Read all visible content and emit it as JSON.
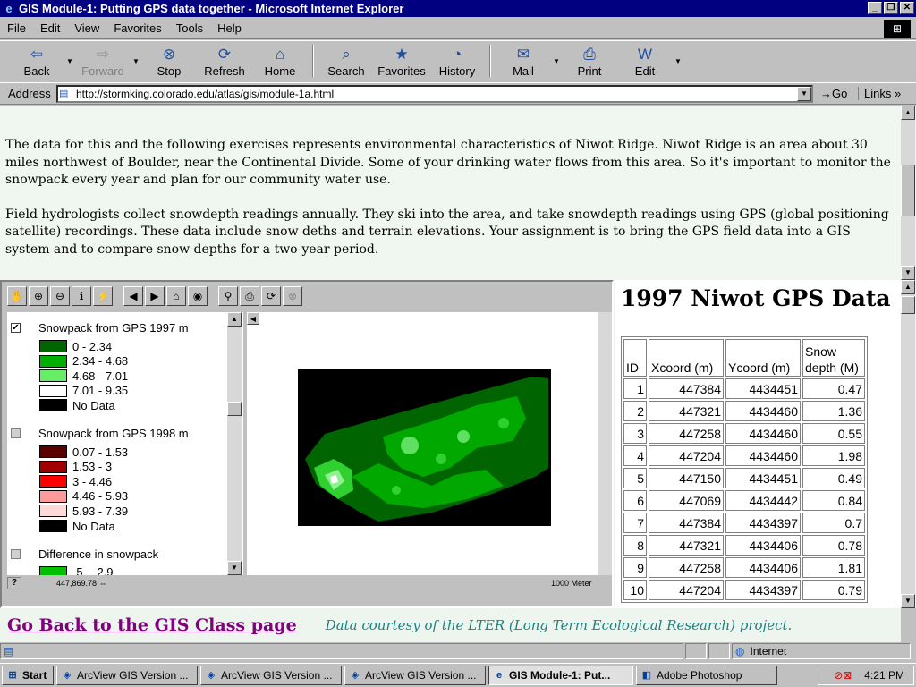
{
  "window": {
    "title": "GIS Module-1: Putting GPS data together - Microsoft Internet Explorer"
  },
  "menu": [
    "File",
    "Edit",
    "View",
    "Favorites",
    "Tools",
    "Help"
  ],
  "toolbar": [
    {
      "label": "Back",
      "glyph": "⇦",
      "enabled": true
    },
    {
      "label": "Forward",
      "glyph": "⇨",
      "enabled": false
    },
    {
      "label": "Stop",
      "glyph": "⊗",
      "enabled": true
    },
    {
      "label": "Refresh",
      "glyph": "⟳",
      "enabled": true
    },
    {
      "label": "Home",
      "glyph": "⌂",
      "enabled": true
    },
    {
      "label": "Search",
      "glyph": "⌕",
      "enabled": true
    },
    {
      "label": "Favorites",
      "glyph": "★",
      "enabled": true
    },
    {
      "label": "History",
      "glyph": "◔",
      "enabled": true
    },
    {
      "label": "Mail",
      "glyph": "✉",
      "enabled": true
    },
    {
      "label": "Print",
      "glyph": "⎙",
      "enabled": true
    },
    {
      "label": "Edit",
      "glyph": "W",
      "enabled": true
    }
  ],
  "address": {
    "label": "Address",
    "url": "http://stormking.colorado.edu/atlas/gis/module-1a.html",
    "go": "Go",
    "links": "Links"
  },
  "content": {
    "para1": "The data for this and the following exercises represents environmental characteristics of Niwot Ridge. Niwot Ridge is an area about 30 miles northwest of Boulder, near the Continental Divide. Some of your drinking water flows from this area. So it's important to monitor the snowpack every year and plan for our community water use.",
    "para2": "Field hydrologists collect snowdepth readings annually. They ski into the area, and take snowdepth readings using GPS (global positioning satellite) recordings. These data include snow deths and terrain elevations. Your assignment is to bring the GPS field data into a GIS system and to compare snow depths for a two-year period."
  },
  "gis": {
    "layers": [
      {
        "name": "Snowpack from GPS 1997 m",
        "checked": true,
        "classes": [
          {
            "label": "0 - 2.34",
            "color": "#006400"
          },
          {
            "label": "2.34 - 4.68",
            "color": "#00b000"
          },
          {
            "label": "4.68 - 7.01",
            "color": "#66ee66"
          },
          {
            "label": "7.01 - 9.35",
            "color": "#ffffff"
          },
          {
            "label": "No Data",
            "color": "#000000"
          }
        ]
      },
      {
        "name": "Snowpack from GPS 1998 m",
        "checked": false,
        "classes": [
          {
            "label": "0.07 - 1.53",
            "color": "#5a0000"
          },
          {
            "label": "1.53 - 3",
            "color": "#a00000"
          },
          {
            "label": "3 - 4.46",
            "color": "#ff0000"
          },
          {
            "label": "4.46 - 5.93",
            "color": "#ff9a9a"
          },
          {
            "label": "5.93 - 7.39",
            "color": "#ffd8d8"
          },
          {
            "label": "No Data",
            "color": "#000000"
          }
        ]
      },
      {
        "name": "Difference in snowpack",
        "checked": false,
        "classes": [
          {
            "label": "-5 - -2.9",
            "color": "#00c000"
          }
        ]
      }
    ],
    "coord": "447,869.78",
    "scale": "1000 Meter"
  },
  "table": {
    "title": "1997 Niwot GPS Data",
    "headers": [
      "ID",
      "Xcoord (m)",
      "Ycoord (m)",
      "Snow depth (M)"
    ],
    "rows": [
      [
        "1",
        "447384",
        "4434451",
        "0.47"
      ],
      [
        "2",
        "447321",
        "4434460",
        "1.36"
      ],
      [
        "3",
        "447258",
        "4434460",
        "0.55"
      ],
      [
        "4",
        "447204",
        "4434460",
        "1.98"
      ],
      [
        "5",
        "447150",
        "4434451",
        "0.49"
      ],
      [
        "6",
        "447069",
        "4434442",
        "0.84"
      ],
      [
        "7",
        "447384",
        "4434397",
        "0.7"
      ],
      [
        "8",
        "447321",
        "4434406",
        "0.78"
      ],
      [
        "9",
        "447258",
        "4434406",
        "1.81"
      ],
      [
        "10",
        "447204",
        "4434397",
        "0.79"
      ]
    ]
  },
  "footer": {
    "link": "Go Back to the GIS Class page",
    "courtesy": "Data courtesy of  the LTER (Long Term Ecological Research) project."
  },
  "statusbar": {
    "zone": "Internet"
  },
  "taskbar": {
    "start": "Start",
    "items": [
      {
        "label": "ArcView GIS Version ...",
        "active": false
      },
      {
        "label": "ArcView GIS Version ...",
        "active": false
      },
      {
        "label": "ArcView GIS Version ...",
        "active": false
      },
      {
        "label": "GIS Module-1: Put...",
        "active": true
      },
      {
        "label": "Adobe Photoshop",
        "active": false
      }
    ],
    "clock": "4:21 PM"
  }
}
